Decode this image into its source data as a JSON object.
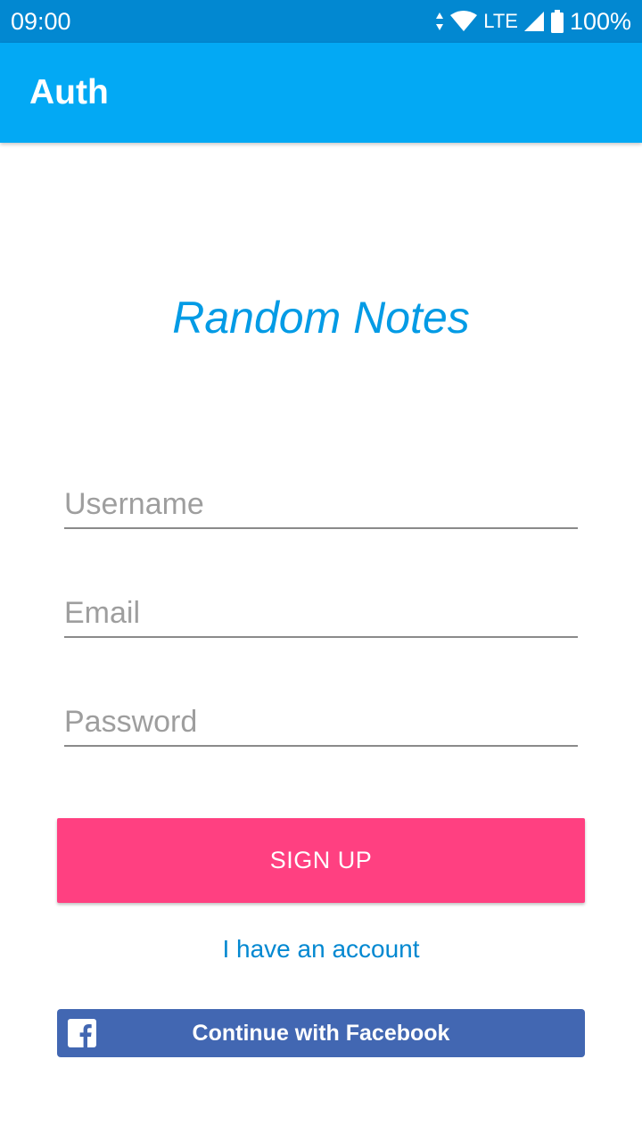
{
  "status_bar": {
    "time": "09:00",
    "network": "LTE",
    "battery": "100%",
    "icons": [
      "data-arrows-icon",
      "wifi-icon",
      "signal-icon",
      "battery-icon"
    ]
  },
  "app_bar": {
    "title": "Auth"
  },
  "logo": {
    "text": "Random Notes"
  },
  "form": {
    "username_placeholder": "Username",
    "email_placeholder": "Email",
    "password_placeholder": "Password",
    "signup_label": "SIGN UP",
    "account_link": "I have an account",
    "facebook_label": "Continue with Facebook"
  },
  "colors": {
    "status_bar": "#0288D1",
    "app_bar": "#03A9F4",
    "accent": "#FF4081",
    "facebook": "#4267B2",
    "link": "#0288D1"
  }
}
